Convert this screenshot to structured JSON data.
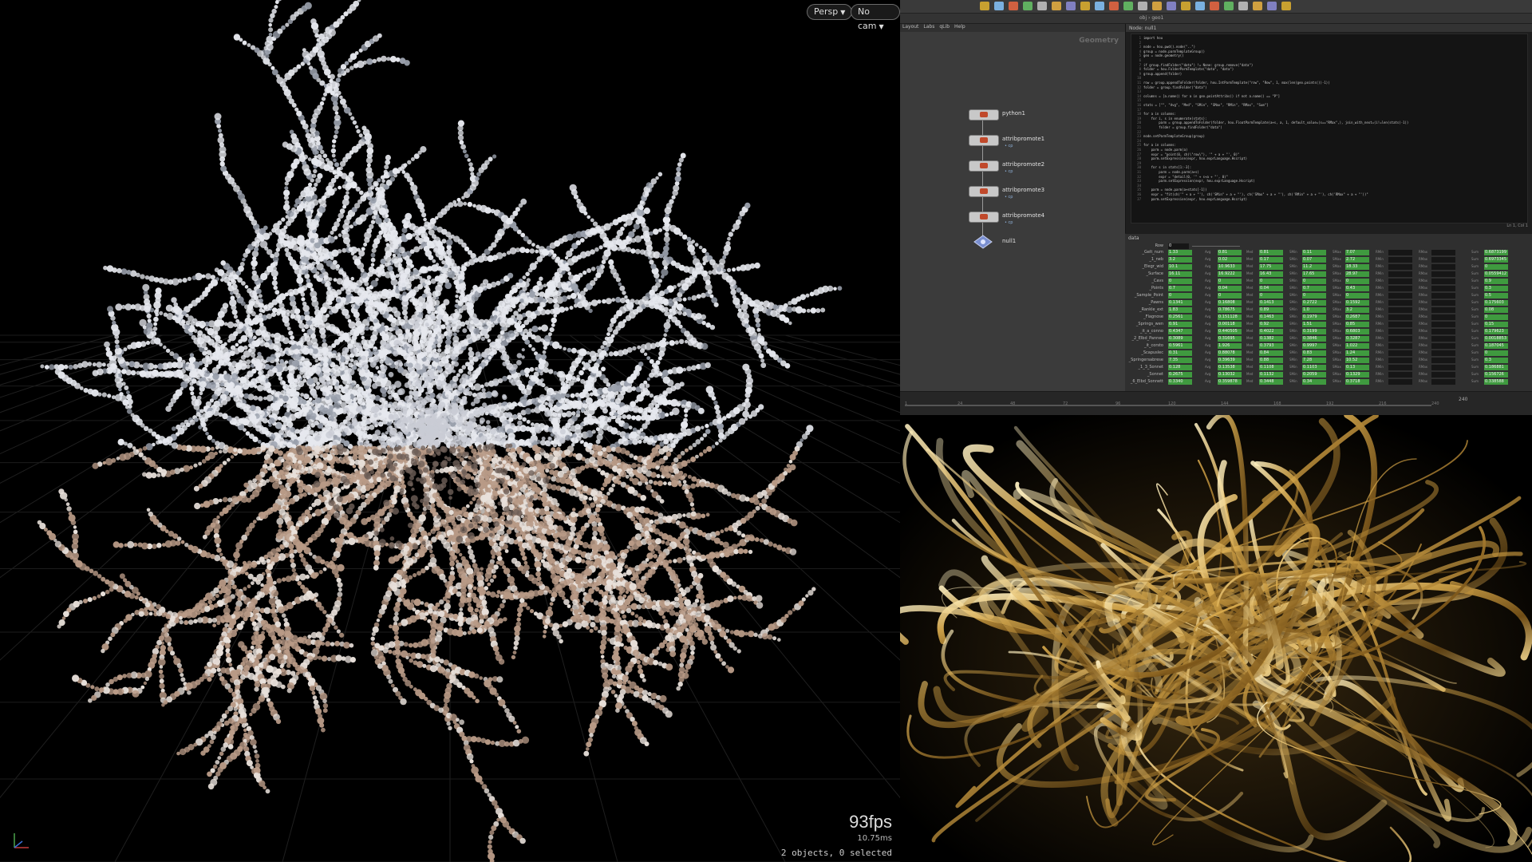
{
  "viewport": {
    "camera_menu": "Persp",
    "cam_select": "No cam",
    "fps": "93fps",
    "frame_time": "10.75ms",
    "selection_status": "2 objects, 0 selected"
  },
  "network": {
    "menu": [
      "Layout",
      "Labs",
      "qLib",
      "Help"
    ],
    "context_label": "Geometry",
    "nodes": [
      {
        "name": "python1",
        "sub": ""
      },
      {
        "name": "attribpromote1",
        "sub": "• cp"
      },
      {
        "name": "attribpromote2",
        "sub": "• cp"
      },
      {
        "name": "attribpromote3",
        "sub": "• cp"
      },
      {
        "name": "attribpromote4",
        "sub": "• cp"
      },
      {
        "name": "null1",
        "sub": ""
      }
    ]
  },
  "pathbar": {
    "path": "obj › geo1"
  },
  "code": {
    "header": "Node: null1",
    "lines": [
      "import hou",
      "",
      "node = hou.pwd().node(\"..\")",
      "group = node.parmTemplateGroup()",
      "geo = node.geometry()",
      "",
      "if group.findFolder(\"data\") != None: group.remove(\"data\")",
      "folder = hou.FolderParmTemplate(\"data\", \"data\")",
      "group.append(folder)",
      "",
      "row = group.appendToFolder(folder, hou.IntParmTemplate(\"row\", \"Row\", 1, max(len(geo.points())-1))",
      "folder = group.findFolder(\"data\")",
      "",
      "columns = [a.name() for a in geo.pointAttribs() if not a.name() == \"P\"]",
      "",
      "stats = [\"\", \"Avg\", \"Med\", \"SMin\", \"SMax\", \"RMin\", \"RMax\", \"Sum\"]",
      "",
      "for a in columns:",
      "    for i, s in enumerate(stats):",
      "        parm = group.appendToFolder(folder, hou.FloatParmTemplate(a+s, a, 1, default_value=(s==\"RMax\",), join_with_next=(i!=len(stats)-1))",
      "        folder = group.findFolder(\"data\")",
      "",
      "node.setParmTemplateGroup(group)",
      "",
      "for a in columns:",
      "    parm = node.parm(a)",
      "    expr = \"point(0, ch(\\\"row\\\"), '\" + a + \"', 0)\"",
      "    parm.setExpression(expr, hou.exprLanguage.Hscript)",
      "",
      "    for s in stats[1:-3]:",
      "        parm = node.parm(a+s)",
      "        expr = \"detail(0, '\" + s+a + \"', 0)\"",
      "        parm.setExpression(expr, hou.exprLanguage.Hscript)",
      "",
      "    parm = node.parm(a+stats[-1])",
      "    expr = \"fit(ch('\" + a + \"'), ch('SMin\" + a + \"'), ch('SMax\" + a + \"'), ch('RMin\" + a + \"'), ch('RMax\" + a + \"'))\"",
      "    parm.setExpression(expr, hou.exprLanguage.Hscript)"
    ],
    "footer": "Ln 1, Col 1"
  },
  "parms": {
    "folder": "data",
    "row_label": "Row",
    "row_value": "0",
    "rows": [
      {
        "label": "_Gelt_num",
        "v": [
          "1.33",
          "0.81",
          "0.81",
          "0.11",
          "7.07",
          "",
          "",
          "0.6873199"
        ]
      },
      {
        "label": "_1_neb",
        "v": [
          "3.2",
          "0.02",
          "0.17",
          "0.07",
          "2.72",
          "",
          "",
          "0.6973345"
        ]
      },
      {
        "label": "_Elegr_wid",
        "v": [
          "10.1",
          "10.9633",
          "17.75",
          "11.2",
          "18.33",
          "",
          "",
          "0"
        ]
      },
      {
        "label": "_Surface",
        "v": [
          "16.11",
          "16.9222",
          "16.43",
          "17.65",
          "28.97",
          "",
          "",
          "0.0559412"
        ]
      },
      {
        "label": "_Cavs",
        "v": [
          "0",
          "0",
          "0",
          "0",
          "0",
          "",
          "",
          "0.9"
        ]
      },
      {
        "label": "_Points",
        "v": [
          "0.7",
          "0.04",
          "0.04",
          "0.7",
          "0.43",
          "",
          "",
          "0.3"
        ]
      },
      {
        "label": "_Sample_Point",
        "v": [
          "0",
          "0",
          "0",
          "0",
          "0",
          "",
          "",
          "0.5"
        ]
      },
      {
        "label": "_Pawns",
        "v": [
          "0.1341",
          "0.16808",
          "0.1413",
          "0.2722",
          "0.1592",
          "",
          "",
          "0.175603"
        ]
      },
      {
        "label": "_Rankle_ext",
        "v": [
          "1.83",
          "0.78675",
          "0.89",
          "1.0",
          "3.2",
          "",
          "",
          "0.08"
        ]
      },
      {
        "label": "_Flagnose",
        "v": [
          "0.2561",
          "0.151128",
          "0.1463",
          "0.1979",
          "0.2687",
          "",
          "",
          "0"
        ]
      },
      {
        "label": "_Springs_wen",
        "v": [
          "0.91",
          "0.00118",
          "0.92",
          "1.51",
          "0.85",
          "",
          "",
          "0.15"
        ]
      },
      {
        "label": "_it_a_conno",
        "v": [
          "0.4347",
          "0.440505",
          "0.4022",
          "0.3199",
          "0.6803",
          "",
          "",
          "0.179623"
        ]
      },
      {
        "label": "_2_Elbd_Pannes",
        "v": [
          "0.3089",
          "0.31695",
          "0.1382",
          "0.3846",
          "0.3287",
          "",
          "",
          "0.0018853"
        ]
      },
      {
        "label": "_it_corsto",
        "v": [
          "0.5961",
          "1.926",
          "0.3793",
          "0.9997",
          "1.022",
          "",
          "",
          "0.187045"
        ]
      },
      {
        "label": "_Scapuslec",
        "v": [
          "0.31",
          "0.88078",
          "0.84",
          "0.83",
          "1.24",
          "",
          "",
          "0"
        ]
      },
      {
        "label": "_Springersabrese",
        "v": [
          "7.35",
          "0.39639",
          "0.88",
          "7.28",
          "10.52",
          "",
          "",
          "0.3"
        ]
      },
      {
        "label": "_1_3_Sonnet",
        "v": [
          "0.128",
          "0.13538",
          "0.1108",
          "0.1103",
          "0.13",
          "",
          "",
          "0.186881"
        ]
      },
      {
        "label": "_Sonnet",
        "v": [
          "0.2675",
          "0.13032",
          "0.1132",
          "0.2059",
          "0.1329",
          "",
          "",
          "0.156726"
        ]
      },
      {
        "label": "_6_Elbd_Sonnett",
        "v": [
          "0.3340",
          "0.359878",
          "0.3448",
          "0.34",
          "0.3718",
          "",
          "",
          "0.338588"
        ]
      }
    ],
    "col_names": [
      "",
      "Avg",
      "Med",
      "SMin",
      "SMax",
      "RMin",
      "RMax",
      "Sum"
    ]
  },
  "timeline": {
    "ticks": [
      "1",
      "24",
      "48",
      "72",
      "96",
      "120",
      "144",
      "168",
      "192",
      "216",
      "240"
    ],
    "end": "240"
  },
  "colors": {
    "accent": "#3f9a3f",
    "node_red": "#c0492b",
    "gold": "#c9a24a"
  }
}
